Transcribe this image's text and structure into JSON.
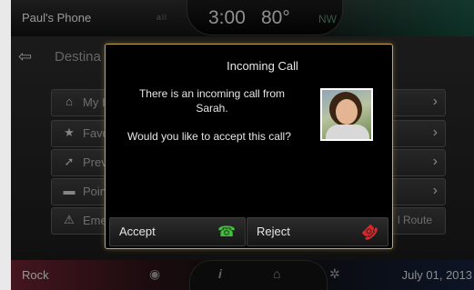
{
  "status_bar": {
    "phone_name": "Paul's Phone",
    "signal": "all",
    "time": "3:00",
    "temperature": "80°",
    "compass": "NW"
  },
  "screen": {
    "back_glyph": "⇦",
    "title": "Destina",
    "rows": [
      {
        "icon": "home-icon",
        "glyph": "⌂",
        "label": "My I",
        "extra": "",
        "chevron": "›"
      },
      {
        "icon": "star-icon",
        "glyph": "★",
        "label": "Favo",
        "extra": "",
        "chevron": "›"
      },
      {
        "icon": "route-icon",
        "glyph": "➚",
        "label": "Prev",
        "extra": "",
        "chevron": "›"
      },
      {
        "icon": "poi-icon",
        "glyph": "▬",
        "label": "Poin",
        "extra": "",
        "chevron": "›"
      },
      {
        "icon": "warning-icon",
        "glyph": "⚠",
        "label": "Eme",
        "extra": "l Route",
        "chevron": ""
      }
    ]
  },
  "dialog": {
    "title": "Incoming Call",
    "message": "There is an incoming call from Sarah.",
    "question": "Would you like to accept this call?",
    "accept_label": "Accept",
    "reject_label": "Reject",
    "accept_glyph": "☎",
    "reject_glyph": "☎",
    "accept_color": "#3fbf3a",
    "reject_color": "#d8282e"
  },
  "bottom_bar": {
    "source": "Rock",
    "date": "July 01, 2013",
    "radio_glyph": "◉",
    "info_glyph": "i",
    "home_glyph": "⌂",
    "settings_glyph": "✲"
  }
}
